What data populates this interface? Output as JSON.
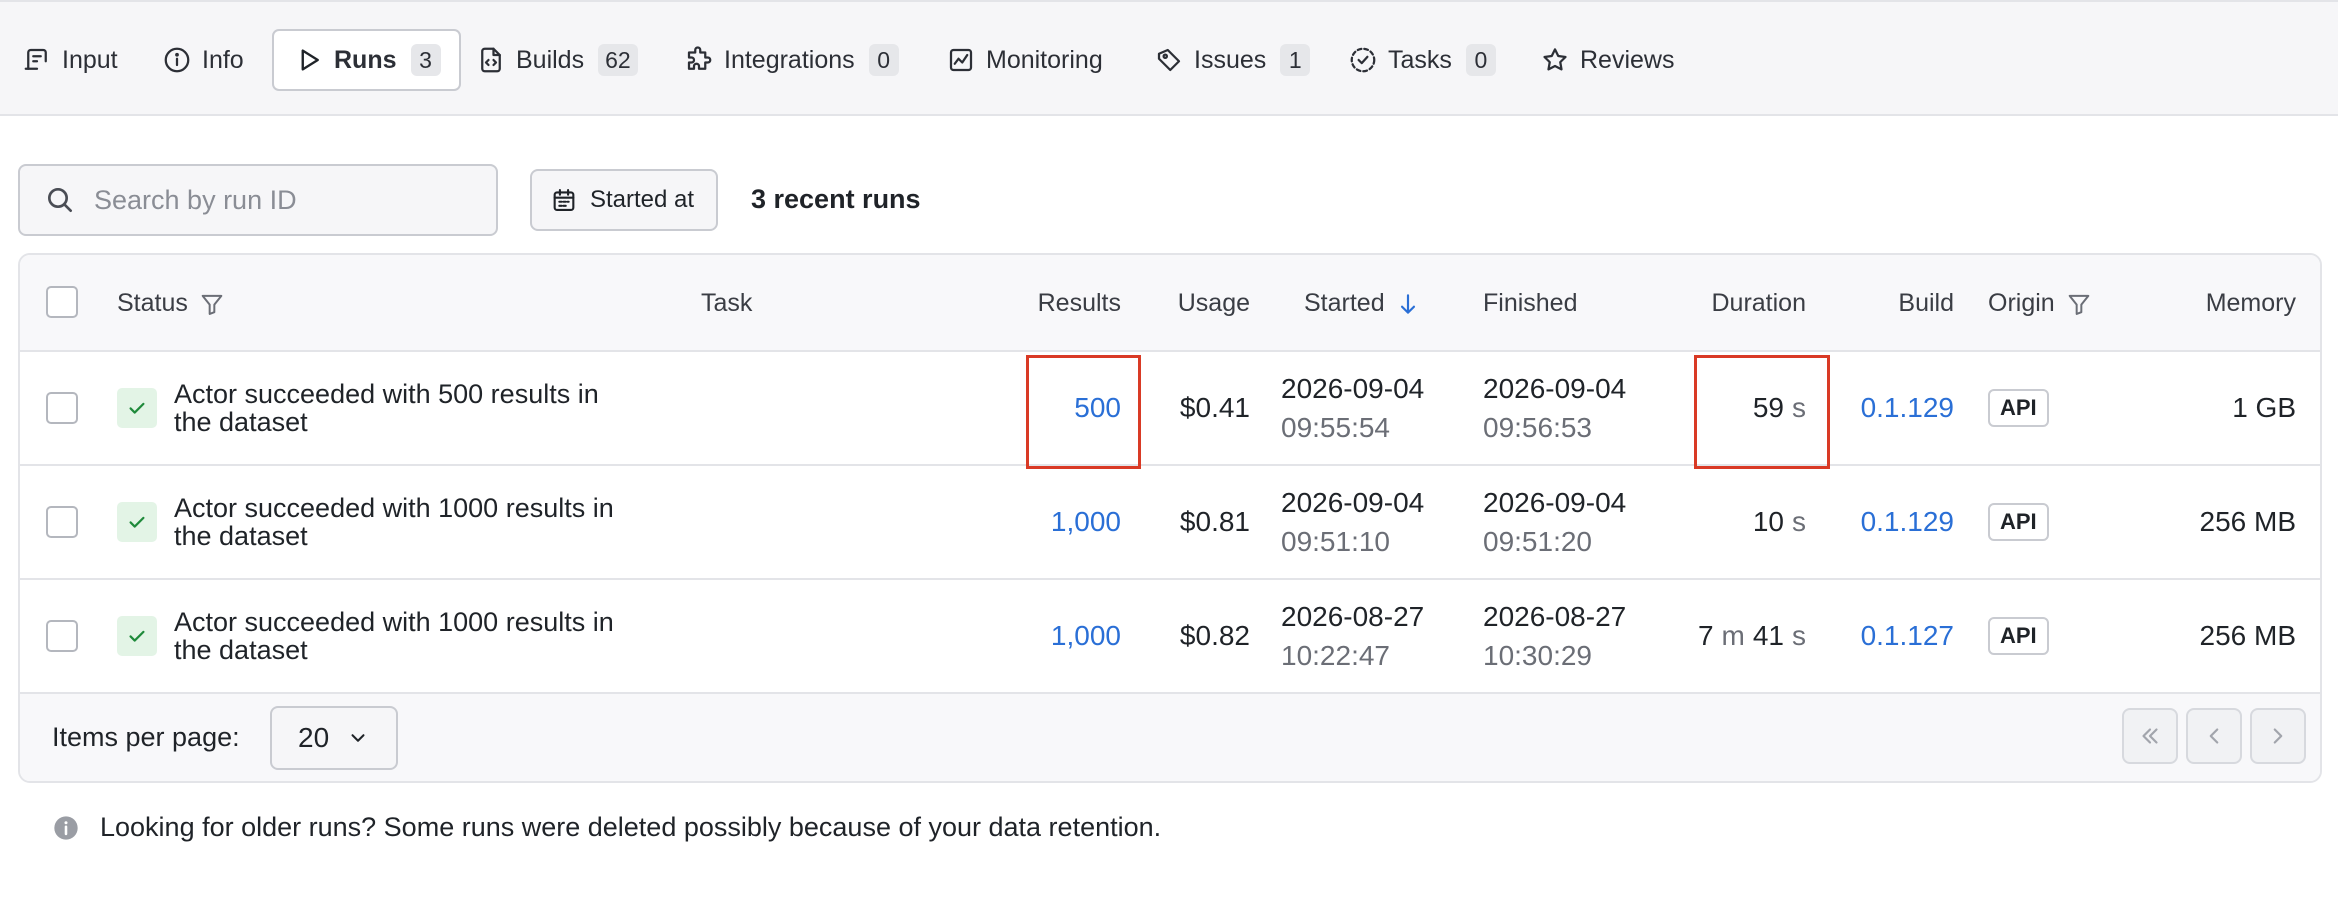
{
  "tabs": [
    {
      "label": "Input",
      "icon": "input-icon",
      "count": null
    },
    {
      "label": "Info",
      "icon": "info-icon",
      "count": null
    },
    {
      "label": "Runs",
      "icon": "play-icon",
      "count": "3",
      "active": true
    },
    {
      "label": "Builds",
      "icon": "file-code-icon",
      "count": "62"
    },
    {
      "label": "Integrations",
      "icon": "puzzle-icon",
      "count": "0"
    },
    {
      "label": "Monitoring",
      "icon": "chart-icon",
      "count": null
    },
    {
      "label": "Issues",
      "icon": "tag-icon",
      "count": "1"
    },
    {
      "label": "Tasks",
      "icon": "task-icon",
      "count": "0"
    },
    {
      "label": "Reviews",
      "icon": "star-icon",
      "count": null
    }
  ],
  "toolbar": {
    "search_placeholder": "Search by run ID",
    "started_at_label": "Started at",
    "recent_runs": "3 recent runs"
  },
  "columns": {
    "status": "Status",
    "task": "Task",
    "results": "Results",
    "usage": "Usage",
    "started": "Started",
    "finished": "Finished",
    "duration": "Duration",
    "build": "Build",
    "origin": "Origin",
    "memory": "Memory"
  },
  "rows": [
    {
      "status_line1": "Actor succeeded with 500 results in",
      "status_line2": "the dataset",
      "task": "",
      "results": "500",
      "usage": "$0.41",
      "started_date": "2026-09-04",
      "started_time": "09:55:54",
      "finished_date": "2026-09-04",
      "finished_time": "09:56:53",
      "duration_a": "",
      "duration_a_unit": "",
      "duration_b": "59",
      "duration_b_unit": "s",
      "build": "0.1.129",
      "origin": "API",
      "memory": "1 GB"
    },
    {
      "status_line1": "Actor succeeded with 1000 results in",
      "status_line2": "the dataset",
      "task": "",
      "results": "1,000",
      "usage": "$0.81",
      "started_date": "2026-09-04",
      "started_time": "09:51:10",
      "finished_date": "2026-09-04",
      "finished_time": "09:51:20",
      "duration_a": "",
      "duration_a_unit": "",
      "duration_b": "10",
      "duration_b_unit": "s",
      "build": "0.1.129",
      "origin": "API",
      "memory": "256 MB"
    },
    {
      "status_line1": "Actor succeeded with 1000 results in",
      "status_line2": "the dataset",
      "task": "",
      "results": "1,000",
      "usage": "$0.82",
      "started_date": "2026-08-27",
      "started_time": "10:22:47",
      "finished_date": "2026-08-27",
      "finished_time": "10:30:29",
      "duration_a": "7",
      "duration_a_unit": "m",
      "duration_b": "41",
      "duration_b_unit": "s",
      "build": "0.1.127",
      "origin": "API",
      "memory": "256 MB"
    }
  ],
  "footer": {
    "items_per_page_label": "Items per page:",
    "items_per_page_value": "20"
  },
  "notice": "Looking for older runs? Some runs were deleted possibly because of your data retention.",
  "colors": {
    "link": "#2a6fd6",
    "success_bg": "#e3f4e6",
    "success": "#1f8a3b",
    "highlight": "#d93a25"
  }
}
